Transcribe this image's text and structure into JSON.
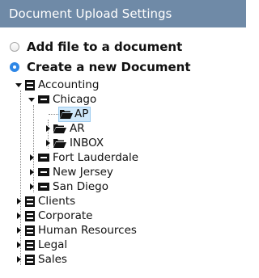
{
  "header": {
    "title": "Document Upload Settings"
  },
  "options": {
    "add_file": "Add file to a document",
    "create_new": "Create a new Document"
  },
  "tree": {
    "accounting": "Accounting",
    "chicago": "Chicago",
    "ap": "AP",
    "ar": "AR",
    "inbox": "INBOX",
    "fort_lauderdale": "Fort Lauderdale",
    "new_jersey": "New Jersey",
    "san_diego": "San Diego",
    "clients": "Clients",
    "corporate": "Corporate",
    "human_resources": "Human Resources",
    "legal": "Legal",
    "sales": "Sales"
  },
  "icons": [
    "cabinet-icon",
    "folder-icon",
    "open-folder-icon",
    "drawer-icon",
    "expand-arrow-icon",
    "collapse-arrow-icon"
  ],
  "colors": {
    "header_bg": "#6f8aa7",
    "radio_selected": "#2e87e6",
    "selection_bg": "#cfe8fb"
  },
  "state": {
    "selected_option": "create_new",
    "selected_node": "AP"
  }
}
